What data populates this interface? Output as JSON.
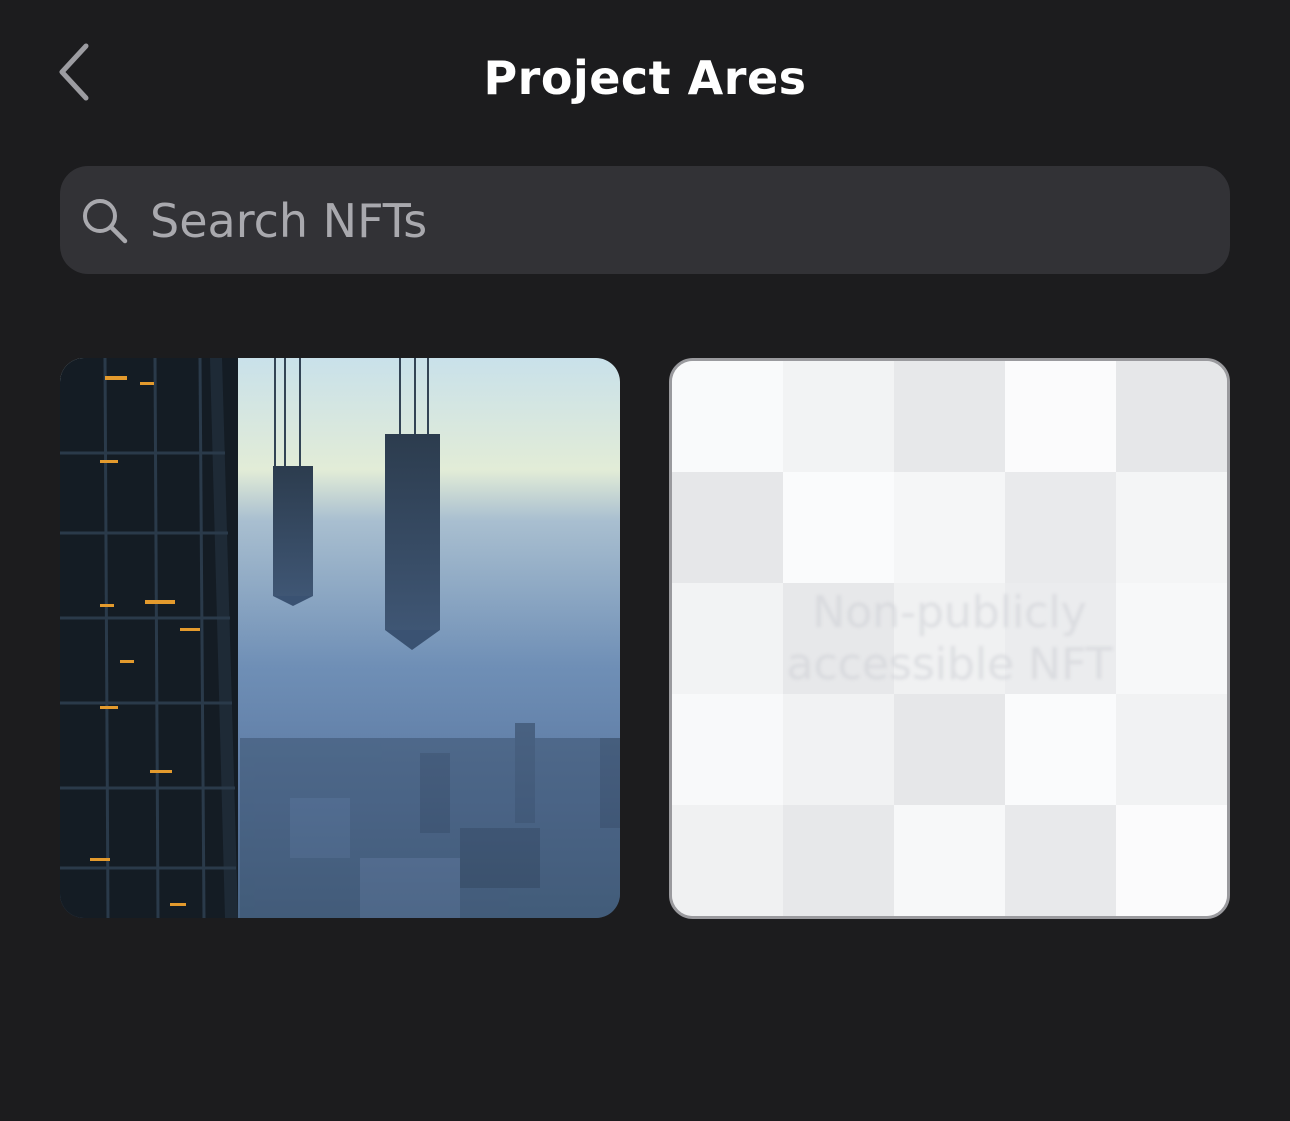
{
  "header": {
    "back_label": "Back",
    "title": "Project Ares"
  },
  "search": {
    "placeholder": "Search NFTs",
    "value": ""
  },
  "nfts": [
    {
      "kind": "image",
      "description": ""
    },
    {
      "kind": "placeholder",
      "label": "Non-publicly accessible NFT"
    }
  ],
  "colors": {
    "background": "#1c1c1e",
    "search_bg": "#323236",
    "title": "#ffffff",
    "placeholder_text": "#a9a9ae"
  }
}
